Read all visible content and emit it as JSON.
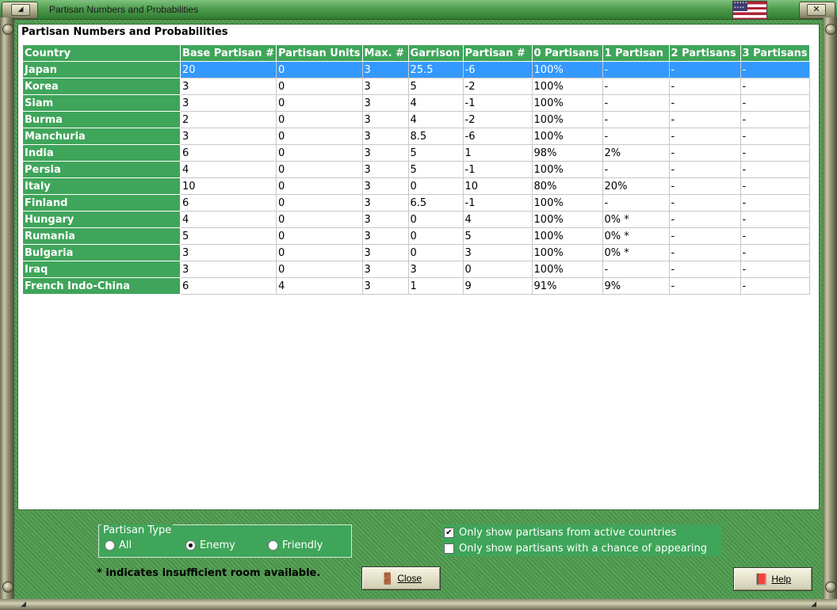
{
  "window": {
    "title": "Partisan Numbers and Probabilities",
    "menu_glyph": "◢",
    "close_glyph": "✕",
    "corner_glyphs": [
      "◢",
      "◢"
    ]
  },
  "panel": {
    "heading": "Partisan Numbers and Probabilities"
  },
  "table": {
    "columns": [
      "Country",
      "Base Partisan #",
      "Partisan Units",
      "Max. #",
      "Garrison",
      "Partisan #",
      "0 Partisans",
      "1 Partisan",
      "2 Partisans",
      "3 Partisans"
    ],
    "rows": [
      [
        "Japan",
        "20",
        "0",
        "3",
        "25.5",
        "-6",
        "100%",
        "-",
        "-",
        "-"
      ],
      [
        "Korea",
        "3",
        "0",
        "3",
        "5",
        "-2",
        "100%",
        "-",
        "-",
        "-"
      ],
      [
        "Siam",
        "3",
        "0",
        "3",
        "4",
        "-1",
        "100%",
        "-",
        "-",
        "-"
      ],
      [
        "Burma",
        "2",
        "0",
        "3",
        "4",
        "-2",
        "100%",
        "-",
        "-",
        "-"
      ],
      [
        "Manchuria",
        "3",
        "0",
        "3",
        "8.5",
        "-6",
        "100%",
        "-",
        "-",
        "-"
      ],
      [
        "India",
        "6",
        "0",
        "3",
        "5",
        "1",
        "98%",
        "2%",
        "-",
        "-"
      ],
      [
        "Persia",
        "4",
        "0",
        "3",
        "5",
        "-1",
        "100%",
        "-",
        "-",
        "-"
      ],
      [
        "Italy",
        "10",
        "0",
        "3",
        "0",
        "10",
        "80%",
        "20%",
        "-",
        "-"
      ],
      [
        "Finland",
        "6",
        "0",
        "3",
        "6.5",
        "-1",
        "100%",
        "-",
        "-",
        "-"
      ],
      [
        "Hungary",
        "4",
        "0",
        "3",
        "0",
        "4",
        "100%",
        "0% *",
        "-",
        "-"
      ],
      [
        "Rumania",
        "5",
        "0",
        "3",
        "0",
        "5",
        "100%",
        "0% *",
        "-",
        "-"
      ],
      [
        "Bulgaria",
        "3",
        "0",
        "3",
        "0",
        "3",
        "100%",
        "0% *",
        "-",
        "-"
      ],
      [
        "Iraq",
        "3",
        "0",
        "3",
        "3",
        "0",
        "100%",
        "-",
        "-",
        "-"
      ],
      [
        "French Indo-China",
        "6",
        "4",
        "3",
        "1",
        "9",
        "91%",
        "9%",
        "-",
        "-"
      ]
    ],
    "selected_row": 0,
    "header_color": "#3fa55a",
    "selection_color": "#3399ff"
  },
  "partisan_type": {
    "legend": "Partisan Type",
    "options": [
      "All",
      "Enemy",
      "Friendly"
    ],
    "selected": "Enemy"
  },
  "filters": {
    "active_only_label": "Only show partisans from active countries",
    "active_only_checked": true,
    "chance_only_label": "Only show partisans with a chance of appearing",
    "chance_only_checked": false
  },
  "footnote": "* indicates insufficient room available.",
  "buttons": {
    "close_label": "Close",
    "close_icon": "door-icon",
    "help_label": "Help",
    "help_icon": "book-icon"
  }
}
